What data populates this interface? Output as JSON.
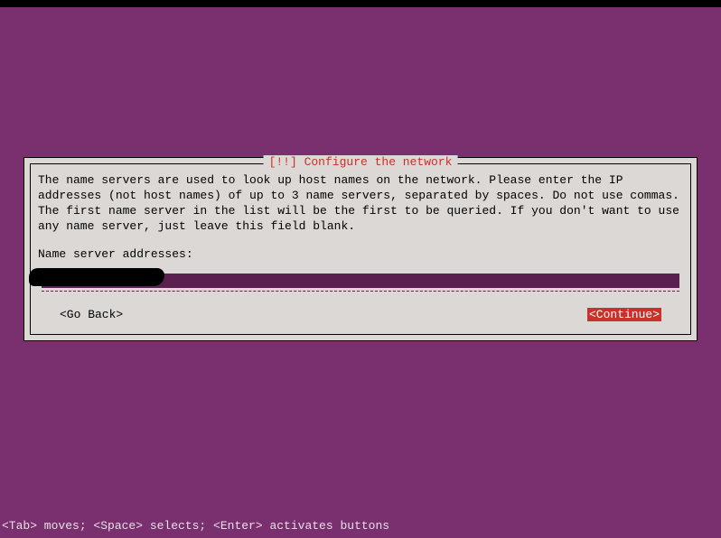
{
  "dialog": {
    "title": "[!!] Configure the network",
    "body": "The name servers are used to look up host names on the network. Please enter the IP addresses (not host names) of up to 3 name servers, separated by spaces. Do not use commas. The first name server in the list will be the first to be queried. If you don't want to use any name server, just leave this field blank.",
    "field_label": "Name server addresses:",
    "input_value": "",
    "go_back": "<Go Back>",
    "continue": "<Continue>"
  },
  "footer": "<Tab> moves; <Space> selects; <Enter> activates buttons"
}
